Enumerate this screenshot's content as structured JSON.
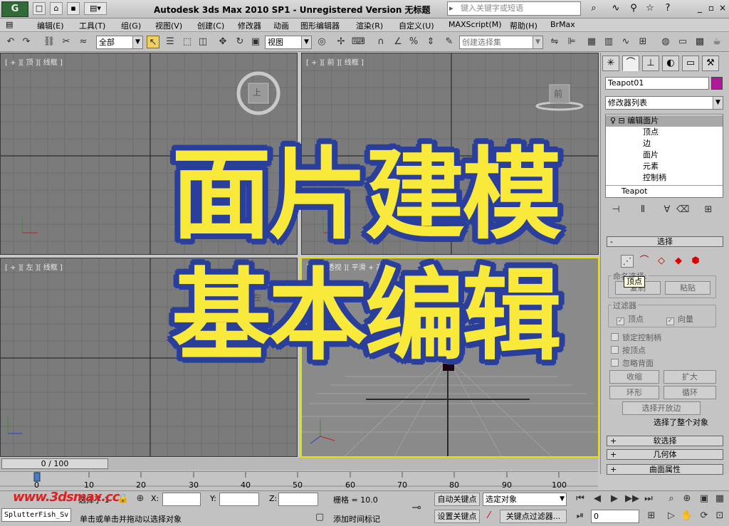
{
  "titlebar": {
    "logo": "G",
    "title": "Autodesk 3ds Max  2010 SP1  -  Unregistered Version     无标题",
    "search_placeholder": "键入关键字或短语"
  },
  "menu": [
    "编辑(E)",
    "工具(T)",
    "组(G)",
    "视图(V)",
    "创建(C)",
    "修改器",
    "动画",
    "图形编辑器",
    "渲染(R)",
    "自定义(U)",
    "MAXScript(M)",
    "帮助(H)",
    "BrMax"
  ],
  "toolbar": {
    "filter_select": "全部",
    "refcoord_select": "视图",
    "named_selection_placeholder": "创建选择集"
  },
  "viewports": {
    "top": "[ + ][ 顶 ][ 线框 ]",
    "front": "[ + ][ 前 ][ 线框 ]",
    "left": "[ + ][ 左 ][ 线框 ]",
    "persp": "[ + ][ 透视 ][ 平滑 + 高光 ]",
    "viewcube_top": "上",
    "viewcube_front": "前",
    "viewcube_left": "左"
  },
  "panel": {
    "object_name": "Teapot01",
    "object_color": "#b0189a",
    "modifier_list": "修改器列表",
    "stack": [
      {
        "label": "编辑面片",
        "level": 0,
        "selected": true
      },
      {
        "label": "顶点",
        "level": 1
      },
      {
        "label": "边",
        "level": 1
      },
      {
        "label": "面片",
        "level": 1
      },
      {
        "label": "元素",
        "level": 1
      },
      {
        "label": "控制柄",
        "level": 1
      },
      {
        "label": "Teapot",
        "level": 0
      }
    ],
    "select_rollout": "选择",
    "named_selections": "命名选择:",
    "copy": "复制",
    "paste": "粘贴",
    "filter_group": "过滤器",
    "filter_vertex": "顶点",
    "filter_vector": "向量",
    "lock_handles": "锁定控制柄",
    "by_vertex": "按顶点",
    "ignore_backfacing": "忽略背面",
    "shrink": "收缩",
    "grow": "扩大",
    "ring": "环形",
    "loop": "循环",
    "select_open_edges": "选择开放边",
    "selected_whole_object": "选择了整个对象",
    "soft_selection": "软选择",
    "geometry": "几何体",
    "surface_properties": "曲面属性",
    "tooltip": "顶点"
  },
  "timeline": {
    "frame_label": "0 / 100",
    "ticks": [
      "0",
      "10",
      "20",
      "30",
      "40",
      "50",
      "60",
      "70",
      "80",
      "90",
      "100"
    ]
  },
  "status": {
    "script_label": "SplutterFish_Sv",
    "selected_count": "选择了 1",
    "x_label": "X:",
    "y_label": "Y:",
    "z_label": "Z:",
    "grid": "栅格 = 10.0",
    "prompt": "单击或单击并拖动以选择对象",
    "add_time_tag": "添加时间标记",
    "auto_key": "自动关键点",
    "set_key": "设置关键点",
    "key_target": "选定对象",
    "key_filters": "关键点过滤器...",
    "frame_value": "0"
  },
  "overlay": {
    "line1": "面片建模",
    "line2": "基本编辑"
  },
  "watermark": "www.3dsmax.cc"
}
